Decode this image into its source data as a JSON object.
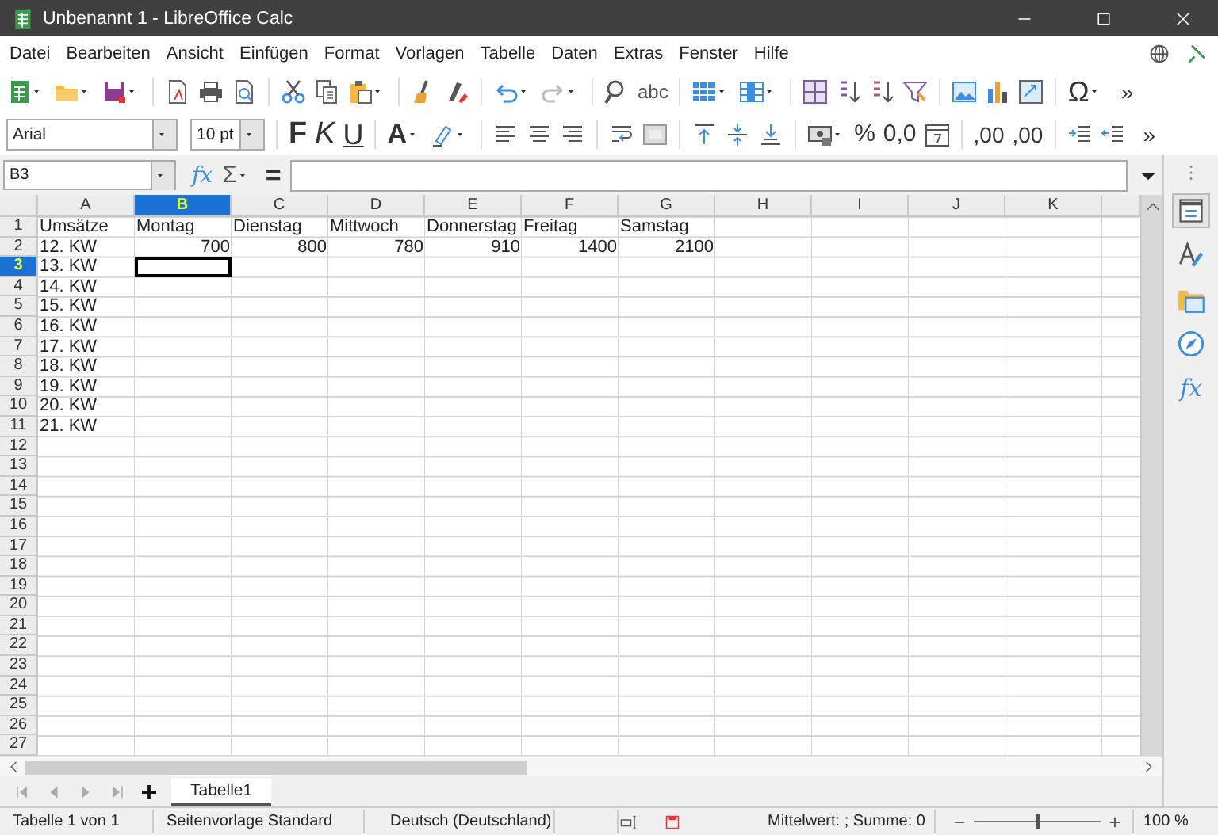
{
  "window": {
    "title": "Unbenannt 1 - LibreOffice Calc"
  },
  "menu": [
    "Datei",
    "Bearbeiten",
    "Ansicht",
    "Einfügen",
    "Format",
    "Vorlagen",
    "Tabelle",
    "Daten",
    "Extras",
    "Fenster",
    "Hilfe"
  ],
  "standard_toolbar": {
    "spelling": "abc",
    "special_character": "Ω",
    "more": "»"
  },
  "formatting_toolbar": {
    "font_name": "Arial",
    "font_size": "10 pt",
    "bold": "F",
    "italic": "K",
    "underline": "U",
    "font_color": "A",
    "percent": "%",
    "number_format": "0,0",
    "add_decimal": ",00",
    "delete_decimal": ",00",
    "more": "»"
  },
  "formula_bar": {
    "name_box": "B3",
    "function_wizard": "fx",
    "sum": "Σ",
    "formula": "="
  },
  "columns": [
    {
      "label": "A",
      "selected": false
    },
    {
      "label": "B",
      "selected": true
    },
    {
      "label": "C",
      "selected": false
    },
    {
      "label": "D",
      "selected": false
    },
    {
      "label": "E",
      "selected": false
    },
    {
      "label": "F",
      "selected": false
    },
    {
      "label": "G",
      "selected": false
    },
    {
      "label": "H",
      "selected": false
    },
    {
      "label": "I",
      "selected": false
    },
    {
      "label": "J",
      "selected": false
    },
    {
      "label": "K",
      "selected": false
    }
  ],
  "rows": [
    {
      "header": "1",
      "selected": false,
      "cells": [
        {
          "text": "Umsätze",
          "kind": "text"
        },
        {
          "text": "Montag",
          "kind": "text"
        },
        {
          "text": "Dienstag",
          "kind": "text"
        },
        {
          "text": "Mittwoch",
          "kind": "text"
        },
        {
          "text": "Donnerstag",
          "kind": "text"
        },
        {
          "text": "Freitag",
          "kind": "text"
        },
        {
          "text": "Samstag",
          "kind": "text"
        }
      ]
    },
    {
      "header": "2",
      "selected": false,
      "cells": [
        {
          "text": "12. KW",
          "kind": "text"
        },
        {
          "text": "700",
          "kind": "number"
        },
        {
          "text": "800",
          "kind": "number"
        },
        {
          "text": "780",
          "kind": "number"
        },
        {
          "text": "910",
          "kind": "number"
        },
        {
          "text": "1400",
          "kind": "number"
        },
        {
          "text": "2100",
          "kind": "number"
        }
      ]
    },
    {
      "header": "3",
      "selected": true,
      "cells": [
        {
          "text": "13. KW",
          "kind": "text"
        }
      ]
    },
    {
      "header": "4",
      "selected": false,
      "cells": [
        {
          "text": "14. KW",
          "kind": "text"
        }
      ]
    },
    {
      "header": "5",
      "selected": false,
      "cells": [
        {
          "text": "15. KW",
          "kind": "text"
        }
      ]
    },
    {
      "header": "6",
      "selected": false,
      "cells": [
        {
          "text": "16. KW",
          "kind": "text"
        }
      ]
    },
    {
      "header": "7",
      "selected": false,
      "cells": [
        {
          "text": "17. KW",
          "kind": "text"
        }
      ]
    },
    {
      "header": "8",
      "selected": false,
      "cells": [
        {
          "text": "18. KW",
          "kind": "text"
        }
      ]
    },
    {
      "header": "9",
      "selected": false,
      "cells": [
        {
          "text": "19. KW",
          "kind": "text"
        }
      ]
    },
    {
      "header": "10",
      "selected": false,
      "cells": [
        {
          "text": "20. KW",
          "kind": "text"
        }
      ]
    },
    {
      "header": "11",
      "selected": false,
      "cells": [
        {
          "text": "21. KW",
          "kind": "text"
        }
      ]
    },
    {
      "header": "12",
      "selected": false
    },
    {
      "header": "13",
      "selected": false
    },
    {
      "header": "14",
      "selected": false
    },
    {
      "header": "15",
      "selected": false
    },
    {
      "header": "16",
      "selected": false
    },
    {
      "header": "17",
      "selected": false
    },
    {
      "header": "18",
      "selected": false
    },
    {
      "header": "19",
      "selected": false
    },
    {
      "header": "20",
      "selected": false
    },
    {
      "header": "21",
      "selected": false
    },
    {
      "header": "22",
      "selected": false
    },
    {
      "header": "23",
      "selected": false
    },
    {
      "header": "24",
      "selected": false
    },
    {
      "header": "25",
      "selected": false
    },
    {
      "header": "26",
      "selected": false
    },
    {
      "header": "27",
      "selected": false
    }
  ],
  "sidebar": {
    "tabs": [
      {
        "selected": true
      },
      {
        "selected": false
      },
      {
        "selected": false
      },
      {
        "selected": false
      },
      {
        "selected": false,
        "text": "fx"
      }
    ]
  },
  "sheet_tabs": [
    {
      "label": "Tabelle1",
      "selected": true
    }
  ],
  "status_bar": {
    "sheet": "Tabelle 1 von 1",
    "page_style": "Seitenvorlage Standard",
    "language": "Deutsch (Deutschland)",
    "summary": "Mittelwert: ; Summe: 0",
    "zoom": {
      "level": 0.5,
      "reading": "100 %"
    }
  }
}
